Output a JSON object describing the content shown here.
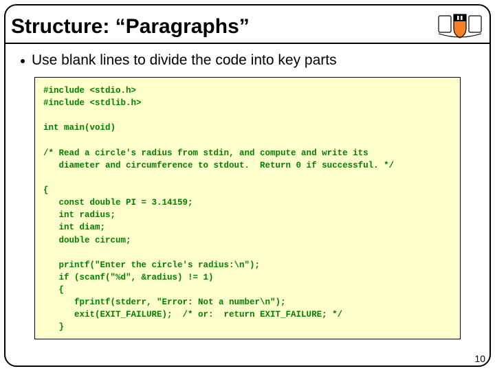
{
  "title": "Structure: “Paragraphs”",
  "bullet": "Use blank lines to divide the code into key parts",
  "code": {
    "l1": "#include <stdio.h>",
    "l2": "#include <stdlib.h>",
    "l3": "",
    "l4": "int main(void)",
    "l5": "",
    "l6": "/* Read a circle's radius from stdin, and compute and write its",
    "l7": "   diameter and circumference to stdout.  Return 0 if successful. */",
    "l8": "",
    "l9": "{",
    "l10": "   const double PI = 3.14159;",
    "l11": "   int radius;",
    "l12": "   int diam;",
    "l13": "   double circum;",
    "l14": "",
    "l15": "   printf(\"Enter the circle's radius:\\n\");",
    "l16": "   if (scanf(\"%d\", &radius) != 1)",
    "l17": "   {",
    "l18": "      fprintf(stderr, \"Error: Not a number\\n\");",
    "l19": "      exit(EXIT_FAILURE);  /* or:  return EXIT_FAILURE; */",
    "l20": "   }",
    "l21": "…"
  },
  "page_number": "10"
}
